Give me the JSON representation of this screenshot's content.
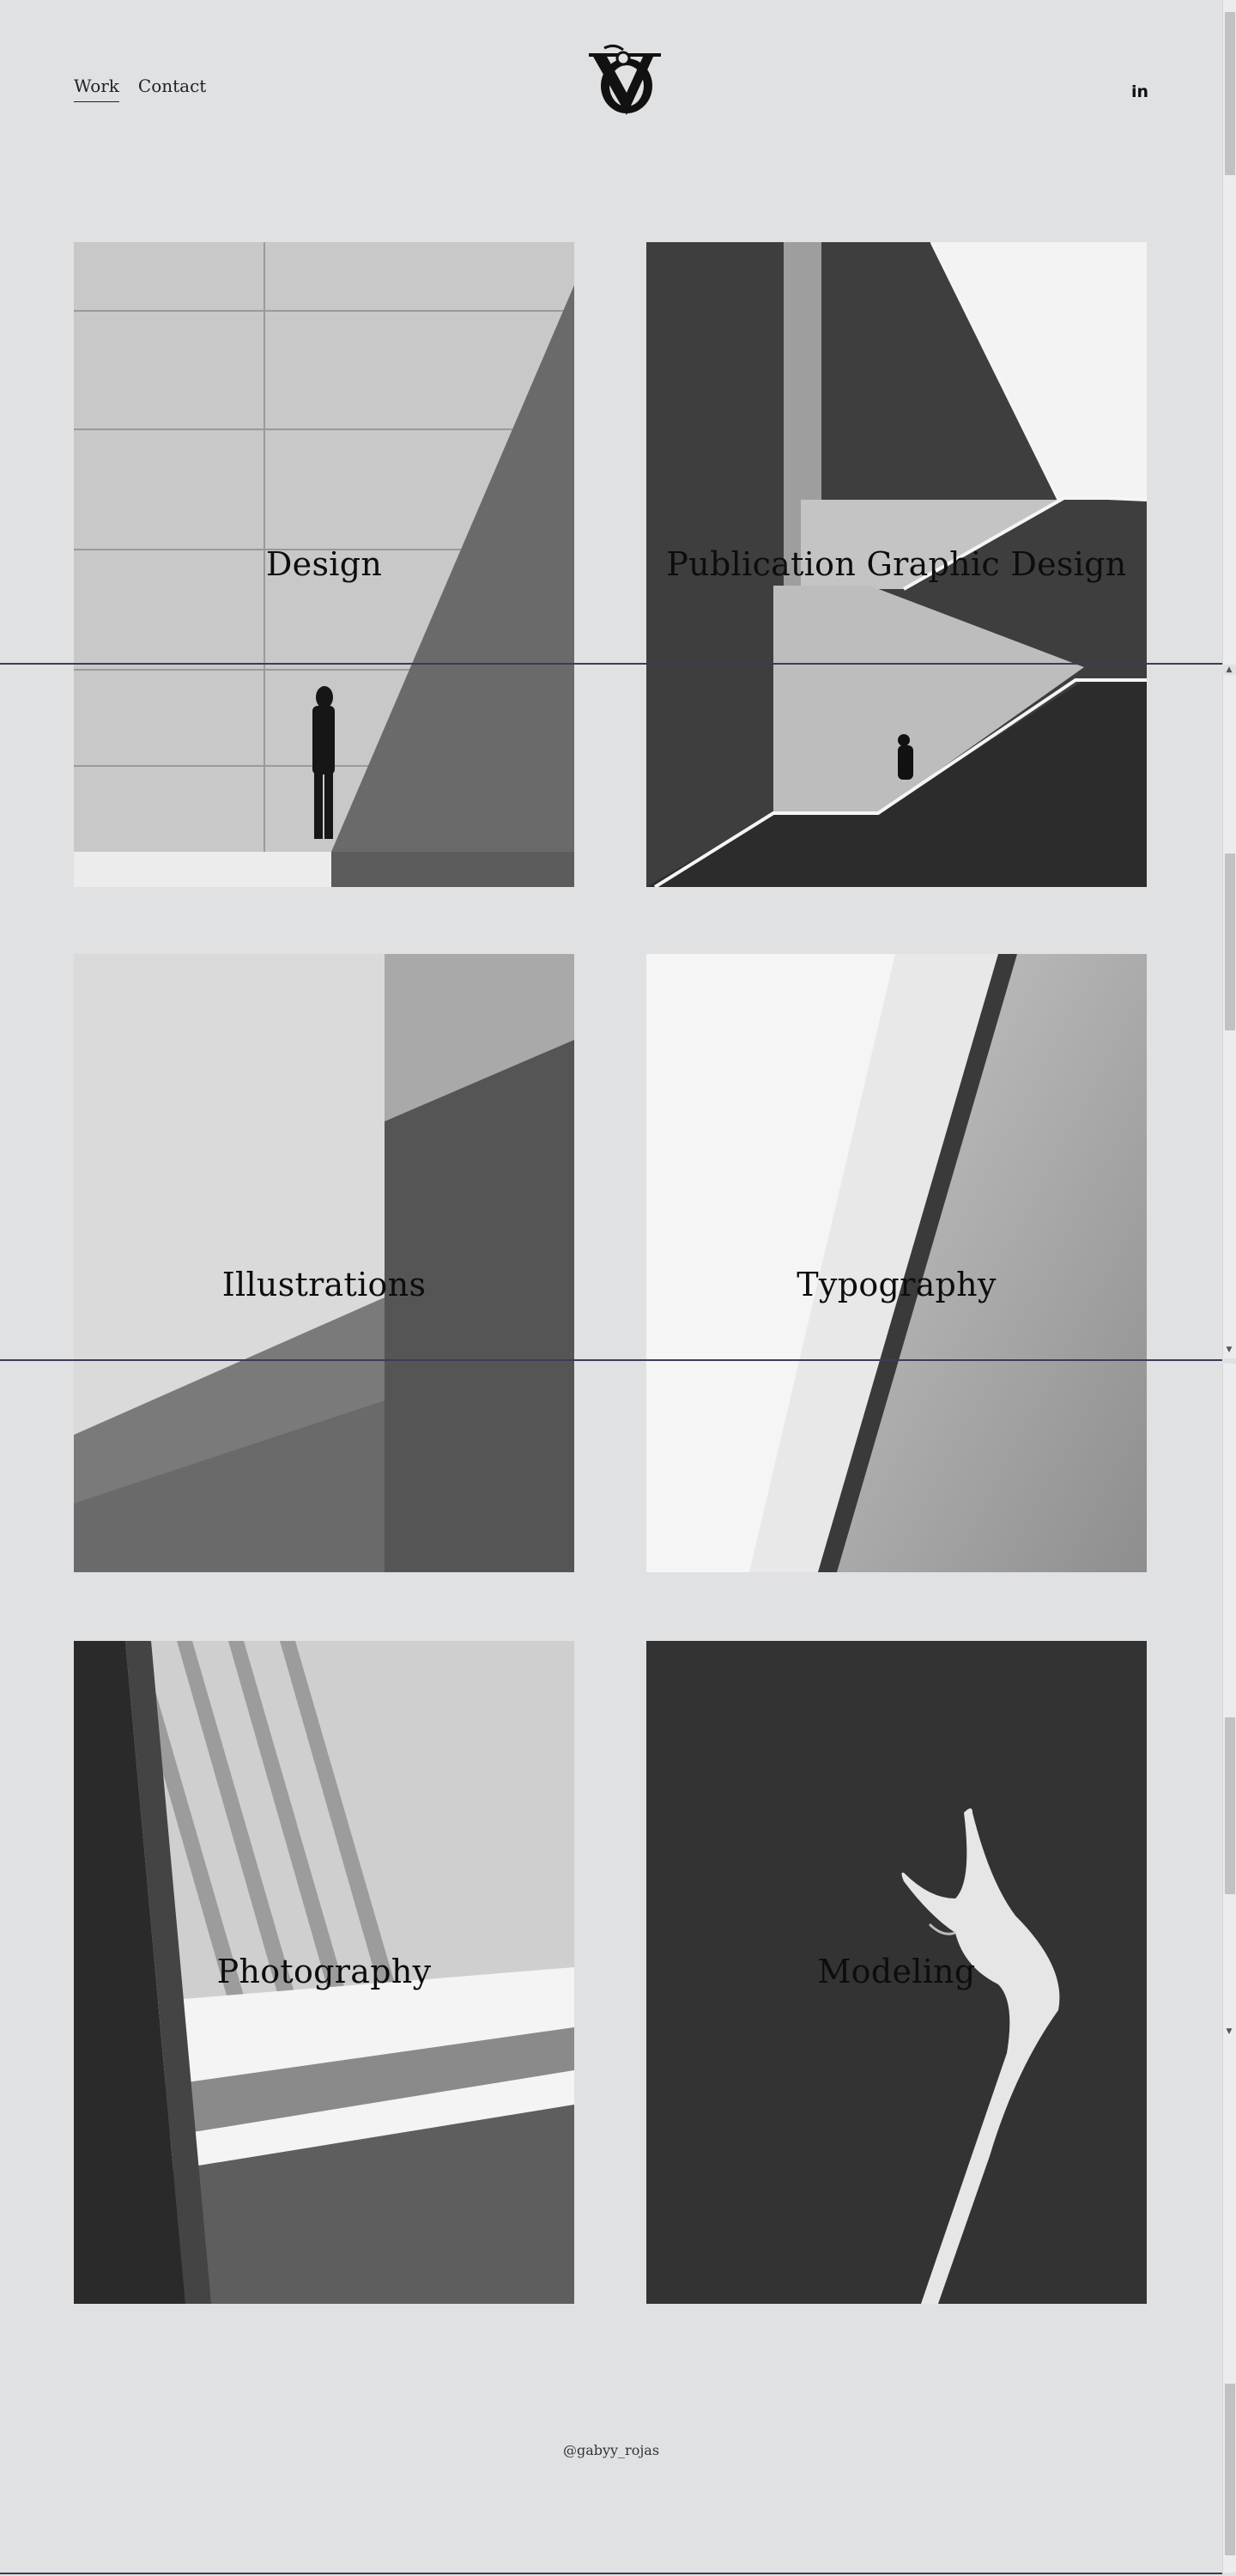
{
  "nav": {
    "items": [
      {
        "label": "Work",
        "active": true
      },
      {
        "label": "Contact",
        "active": false
      }
    ]
  },
  "logo": {
    "alt": "V monogram"
  },
  "social": {
    "label": "in",
    "icon": "linkedin-icon"
  },
  "cards": [
    {
      "title": "Design",
      "image": "concrete-wall-person-photo"
    },
    {
      "title": "Publication Graphic Design",
      "image": "stairs-person-photo"
    },
    {
      "title": "Illustrations",
      "image": "wall-shadow-photo"
    },
    {
      "title": "Typography",
      "image": "diagonal-light-photo"
    },
    {
      "title": "Photography",
      "image": "sunlight-beams-photo"
    },
    {
      "title": "Modeling",
      "image": "hand-raised-photo"
    }
  ],
  "footer": {
    "handle": "@gabyy_rojas"
  },
  "colors": {
    "background": "#e0e1e3",
    "guide_line": "#3a3d55",
    "text": "#111111"
  }
}
